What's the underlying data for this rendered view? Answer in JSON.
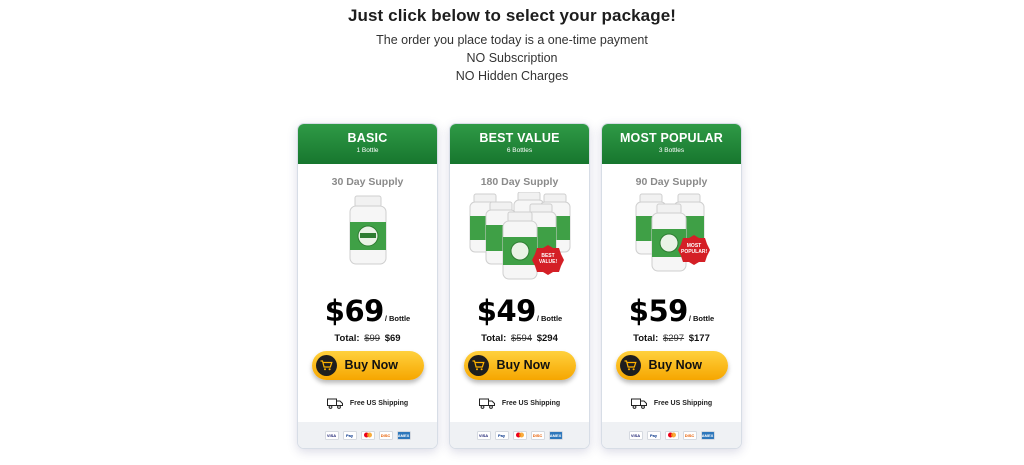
{
  "header": {
    "headline": "Just click below to select your package!",
    "lines": [
      "The order you place today is a one-time payment",
      "NO Subscription",
      "NO Hidden Charges"
    ]
  },
  "packages": [
    {
      "tier": "BASIC",
      "bottles_label": "1 Bottle",
      "supply": "30 Day Supply",
      "price": "$69",
      "per": "/ Bottle",
      "total_label": "Total:",
      "old_total": "$99",
      "new_total": "$69",
      "buy_label": "Buy Now",
      "shipping": "Free US Shipping",
      "bottle_count_shown": 1,
      "badge": ""
    },
    {
      "tier": "BEST VALUE",
      "bottles_label": "6 Bottles",
      "supply": "180 Day Supply",
      "price": "$49",
      "per": "/ Bottle",
      "total_label": "Total:",
      "old_total": "$594",
      "new_total": "$294",
      "buy_label": "Buy Now",
      "shipping": "Free US Shipping",
      "bottle_count_shown": 6,
      "badge": "BEST VALUE!"
    },
    {
      "tier": "MOST POPULAR",
      "bottles_label": "3 Bottles",
      "supply": "90 Day Supply",
      "price": "$59",
      "per": "/ Bottle",
      "total_label": "Total:",
      "old_total": "$297",
      "new_total": "$177",
      "buy_label": "Buy Now",
      "shipping": "Free US Shipping",
      "bottle_count_shown": 3,
      "badge": "MOST POPULAR!"
    }
  ],
  "payment_methods": [
    "VISA",
    "PayPal",
    "Mastercard",
    "Discover",
    "Amex"
  ],
  "colors": {
    "header_green": "#17762e",
    "button_yellow": "#f6a600",
    "badge_red": "#d41f26",
    "label_green": "#2f9a46"
  }
}
